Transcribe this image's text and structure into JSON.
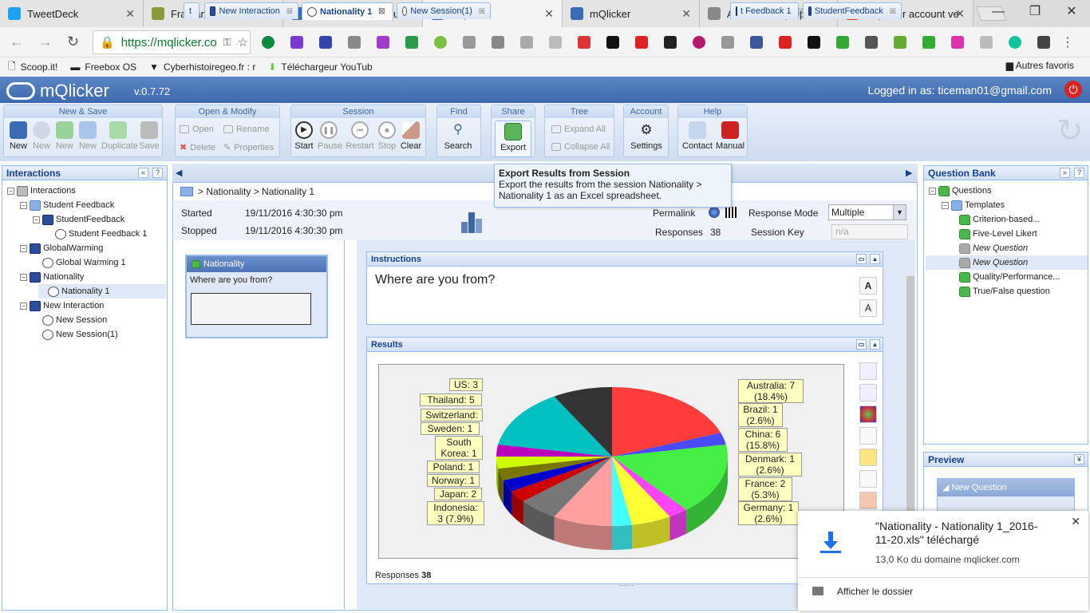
{
  "browser": {
    "tabs": [
      {
        "label": "TweetDeck",
        "color": "#1da1f2",
        "icon": "twitter-icon"
      },
      {
        "label": "Framanotes",
        "color": "#8a9a3a",
        "icon": "note-icon"
      },
      {
        "label": "mQlicker – Free Auc",
        "color": "#3b6bb5",
        "icon": "mqlicker-icon"
      },
      {
        "label": "mQlicker",
        "color": "#3b6bb5",
        "icon": "mqlicker-icon"
      },
      {
        "label": "mQlicker",
        "color": "#3b6bb5",
        "icon": "mqlicker-icon"
      },
      {
        "label": "Articles ‹ Le propuls",
        "color": "#888888",
        "icon": "page-icon"
      },
      {
        "label": "mQlicker account ve",
        "color": "#d93025",
        "icon": "gmail-icon"
      }
    ],
    "url": "https://mqlicker.co",
    "bookmarks": [
      "Scoop.it!",
      "Freebox OS",
      "Cyberhistoiregeo.fr : r",
      "Téléchargeur YouTub"
    ],
    "bookmarks_other": "Autres favoris"
  },
  "app": {
    "name": "mQlicker",
    "version": "v.0.7.72",
    "logged_in": "Logged in as: ticeman01@gmail.com"
  },
  "ribbon": {
    "groups": [
      "New & Save",
      "Open & Modify",
      "Session",
      "Find",
      "Share",
      "Tree",
      "Account",
      "Help"
    ],
    "new_save": [
      "New",
      "New",
      "New",
      "New",
      "Duplicate",
      "Save"
    ],
    "open_modify": [
      "Open",
      "Rename",
      "Delete",
      "Properties"
    ],
    "session": [
      "Start",
      "Pause",
      "Restart",
      "Stop",
      "Clear"
    ],
    "find": "Search",
    "share": "Export",
    "tree": [
      "Expand All",
      "Collapse All"
    ],
    "account": "Settings",
    "help": [
      "Contact",
      "Manual"
    ]
  },
  "interactions": {
    "title": "Interactions",
    "rows": [
      "Interactions",
      "Student Feedback",
      "StudentFeedback",
      "Student Feedback 1",
      "GlobalWarming",
      "Global Warming 1",
      "Nationality",
      "Nationality 1",
      "New Interaction",
      "New Session",
      "New Session(1)"
    ]
  },
  "center": {
    "tabs": [
      "t",
      "New Interaction",
      "Nationality 1",
      "New Session(1)",
      "t Feedback 1",
      "StudentFeedback"
    ],
    "breadcrumb": "> Nationality > Nationality 1",
    "started_label": "Started",
    "started_value": "19/11/2016 4:30:30 pm",
    "stopped_label": "Stopped",
    "stopped_value": "19/11/2016 4:30:30 pm",
    "permalink_label": "Permalink",
    "response_mode_label": "Response Mode",
    "response_mode_value": "Multiple",
    "responses_label": "Responses",
    "responses_value": "38",
    "session_key_label": "Session Key",
    "session_key_placeholder": "n/a",
    "question_card_title": "Nationality",
    "question_card_text": "Where are you from?",
    "instructions_title": "Instructions",
    "instructions_text": "Where are you from?",
    "results_title": "Results",
    "results_responses_label": "Responses",
    "results_responses_value": "38"
  },
  "tooltip": {
    "title": "Export Results from Session",
    "body": "Export the results from the session Nationality > Nationality 1 as an Excel spreadsheet."
  },
  "chart_data": {
    "type": "pie",
    "categories": [
      "Australia",
      "Brazil",
      "China",
      "Denmark",
      "France",
      "Germany",
      "Indonesia",
      "Japan",
      "Norway",
      "Poland",
      "South Korea",
      "Sweden",
      "Switzerland",
      "Thailand",
      "US"
    ],
    "values": [
      7,
      1,
      6,
      1,
      2,
      1,
      3,
      2,
      1,
      1,
      1,
      1,
      1,
      5,
      3
    ],
    "labels": [
      "Australia: 7 (18.4%)",
      "Brazil: 1 (2.6%)",
      "China: 6 (15.8%)",
      "Denmark: 1 (2.6%)",
      "France: 2 (5.3%)",
      "Germany: 1 (2.6%)",
      "Indonesia: 3 (7.9%)",
      "Japan: 2",
      "Norway: 1",
      "Poland: 1",
      "South Korea: 1",
      "Sweden: 1",
      "Switzerland:",
      "Thailand: 5",
      "US: 3"
    ],
    "colors": [
      "#ff3b3b",
      "#4a4aff",
      "#44ee44",
      "#ff44ff",
      "#ffff33",
      "#44ffff",
      "#ffa0a0",
      "#777777",
      "#cc0000",
      "#0000cc",
      "#777700",
      "#ccff00",
      "#bb00bb",
      "#00c0c0",
      "#333333"
    ]
  },
  "question_bank": {
    "title": "Question Bank",
    "rows": [
      "Questions",
      "Templates",
      "Criterion-based...",
      "Five-Level Likert",
      "New Question",
      "New Question",
      "Quality/Performance...",
      "True/False question"
    ]
  },
  "preview": {
    "title": "Preview",
    "card_title": "New Question"
  },
  "download": {
    "filename": "\"Nationality - Nationality 1_2016-11-20.xls\" téléchargé",
    "meta": "13,0 Ko du domaine mqlicker.com",
    "folder": "Afficher le dossier"
  }
}
